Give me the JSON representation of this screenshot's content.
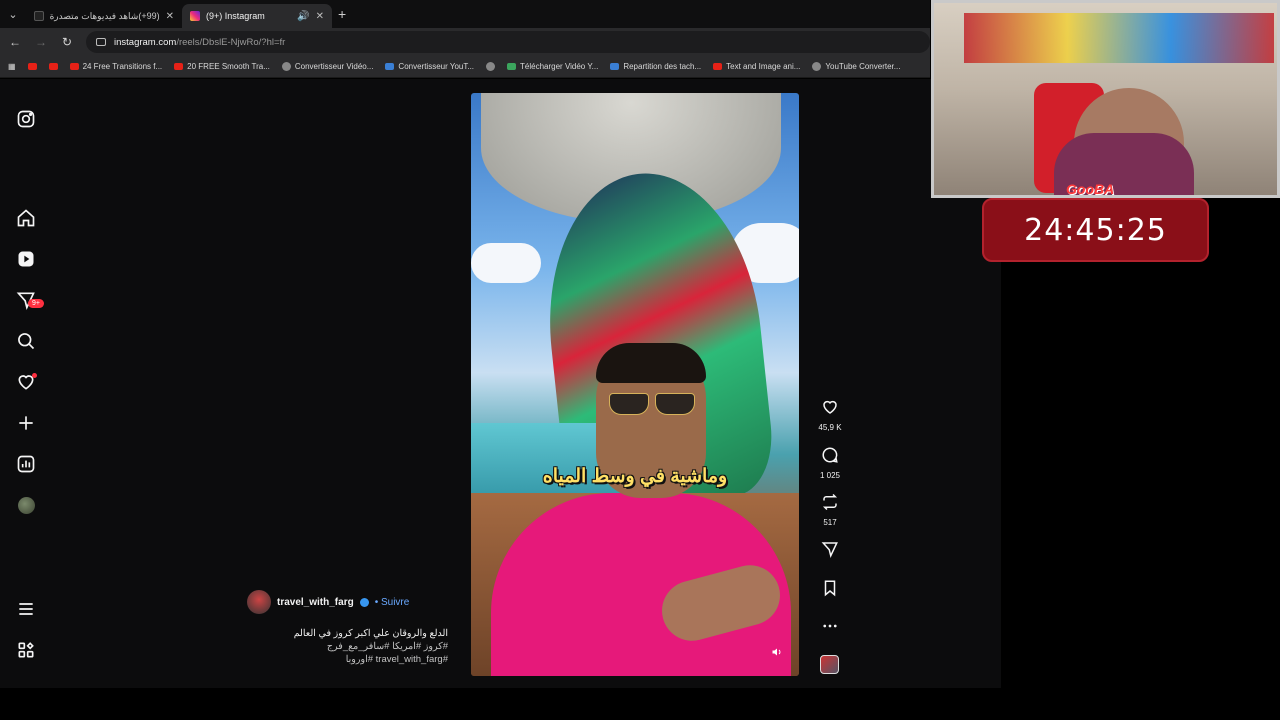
{
  "browser": {
    "tabs": [
      {
        "title": "(99+)شاهد فيديوهات متصدرة |",
        "favicon": "tiktok-icon"
      },
      {
        "title": "(9+) Instagram",
        "favicon": "instagram-icon"
      }
    ],
    "url_host": "instagram.com",
    "url_path": "/reels/DbslE-NjwRo/?hl=fr",
    "bookmarks": [
      {
        "label": "",
        "icon": "youtube-icon"
      },
      {
        "label": "",
        "icon": "youtube-icon"
      },
      {
        "label": "24 Free Transitions f...",
        "icon": "youtube-icon"
      },
      {
        "label": "20 FREE Smooth Tra...",
        "icon": "youtube-icon"
      },
      {
        "label": "Convertisseur Vidéo...",
        "icon": "chrome-icon"
      },
      {
        "label": "Convertisseur YouT...",
        "icon": "link-icon"
      },
      {
        "label": "",
        "icon": "globe-icon"
      },
      {
        "label": "Télécharger Vidéo Y...",
        "icon": "download-icon"
      },
      {
        "label": "Repartition des tach...",
        "icon": "docs-icon"
      },
      {
        "label": "Text and Image ani...",
        "icon": "youtube-icon"
      },
      {
        "label": "YouTube Converter...",
        "icon": "globe-icon"
      }
    ]
  },
  "sidebar": {
    "notifications_badge": "9+"
  },
  "reel": {
    "subtitle": "وماشية في وسط المياه",
    "likes": "45,9 K",
    "comments": "1 025",
    "reposts": "517"
  },
  "author": {
    "username": "travel_with_farg",
    "follow_label": "• Suivre"
  },
  "caption": {
    "line1": "الدلع والروقان علي اكبر كروز في العالم",
    "line2": "#كروز #امريكا #سافر_مع_فرج",
    "line3": "#travel_with_farg #اوروبا"
  },
  "overlay": {
    "timer": "24:45:25",
    "cam_logo": "GooBA"
  },
  "colors": {
    "accent": "#ff3040",
    "link": "#6aa9ff",
    "timer_bg": "#8a0f18"
  }
}
